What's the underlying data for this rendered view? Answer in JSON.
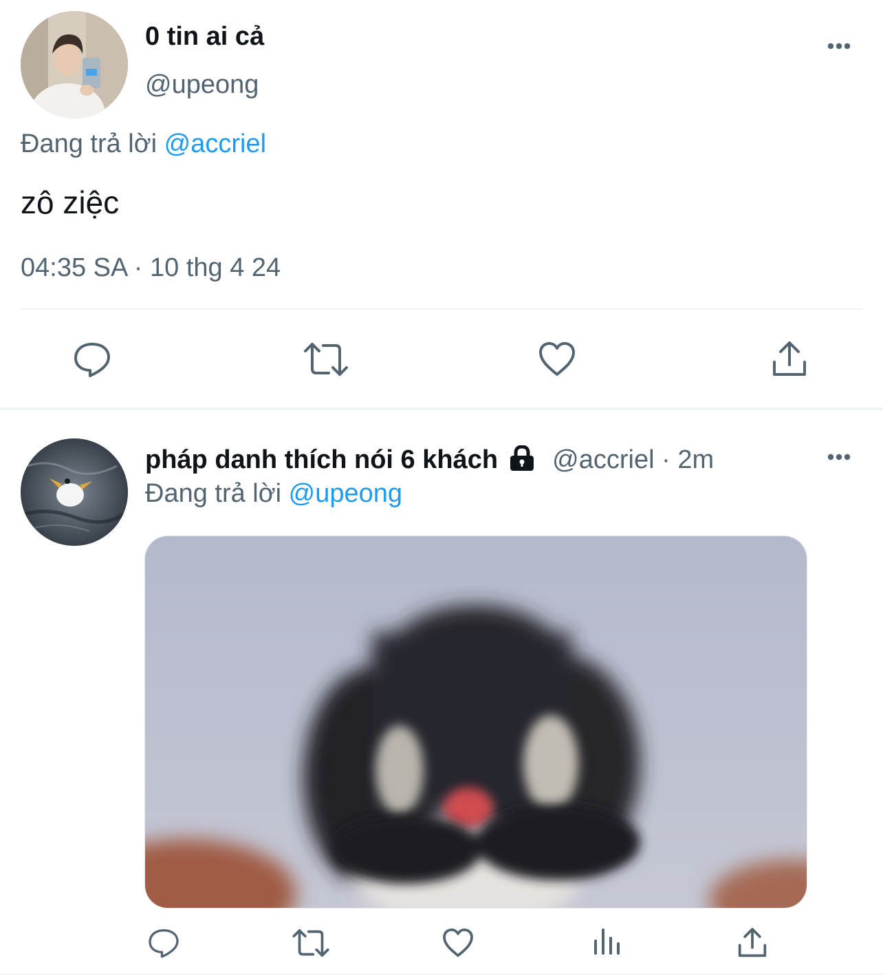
{
  "main_tweet": {
    "display_name": "0 tin ai cả",
    "handle": "@upeong",
    "replying_prefix": "Đang trả lời",
    "replying_to": "@accriel",
    "text": "zô ziệc",
    "timestamp": "04:35 SA · 10 thg 4 24",
    "icons": [
      "more-icon",
      "reply-icon",
      "retweet-icon",
      "like-icon",
      "share-icon"
    ]
  },
  "reply_tweet": {
    "display_name": "pháp danh thích nói 6 khách",
    "protected_icon": "lock-icon",
    "handle": "@accriel",
    "separator": "·",
    "time_ago": "2m",
    "replying_prefix": "Đang trả lời",
    "replying_to": "@upeong",
    "icons": [
      "more-icon",
      "reply-icon",
      "retweet-icon",
      "like-icon",
      "views-icon",
      "share-icon"
    ]
  },
  "colors": {
    "link_blue": "#1d9bf0",
    "secondary_gray": "#536471",
    "divider": "#eff3f4"
  }
}
